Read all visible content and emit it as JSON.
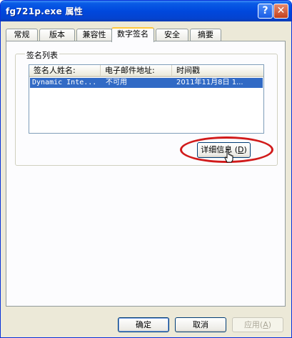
{
  "window": {
    "title": "fg721p.exe 属性",
    "help_label": "?",
    "close_label": "✕",
    "help_icon": "question-icon",
    "close_icon": "close-icon"
  },
  "tabs": [
    {
      "label": "常规"
    },
    {
      "label": "版本"
    },
    {
      "label": "兼容性"
    },
    {
      "label": "数字签名",
      "active": true
    },
    {
      "label": "安全"
    },
    {
      "label": "摘要"
    }
  ],
  "signature_group": {
    "label": "签名列表",
    "columns": [
      "签名人姓名:",
      "电子邮件地址:",
      "时间戳"
    ],
    "rows": [
      {
        "signer": "Dynamic Inte...",
        "email": "不可用",
        "timestamp": "2011年11月8日 1..."
      }
    ],
    "details_button": {
      "text": "详细信息 ",
      "accel_prefix": "(",
      "accel": "D",
      "accel_suffix": ")"
    }
  },
  "buttons": {
    "ok": "确定",
    "cancel": "取消",
    "apply_text": "应用(",
    "apply_accel": "A",
    "apply_suffix": ")"
  },
  "colors": {
    "titlebar": "#0048dd",
    "selection": "#316ac5",
    "annotation": "#d11a1a"
  }
}
